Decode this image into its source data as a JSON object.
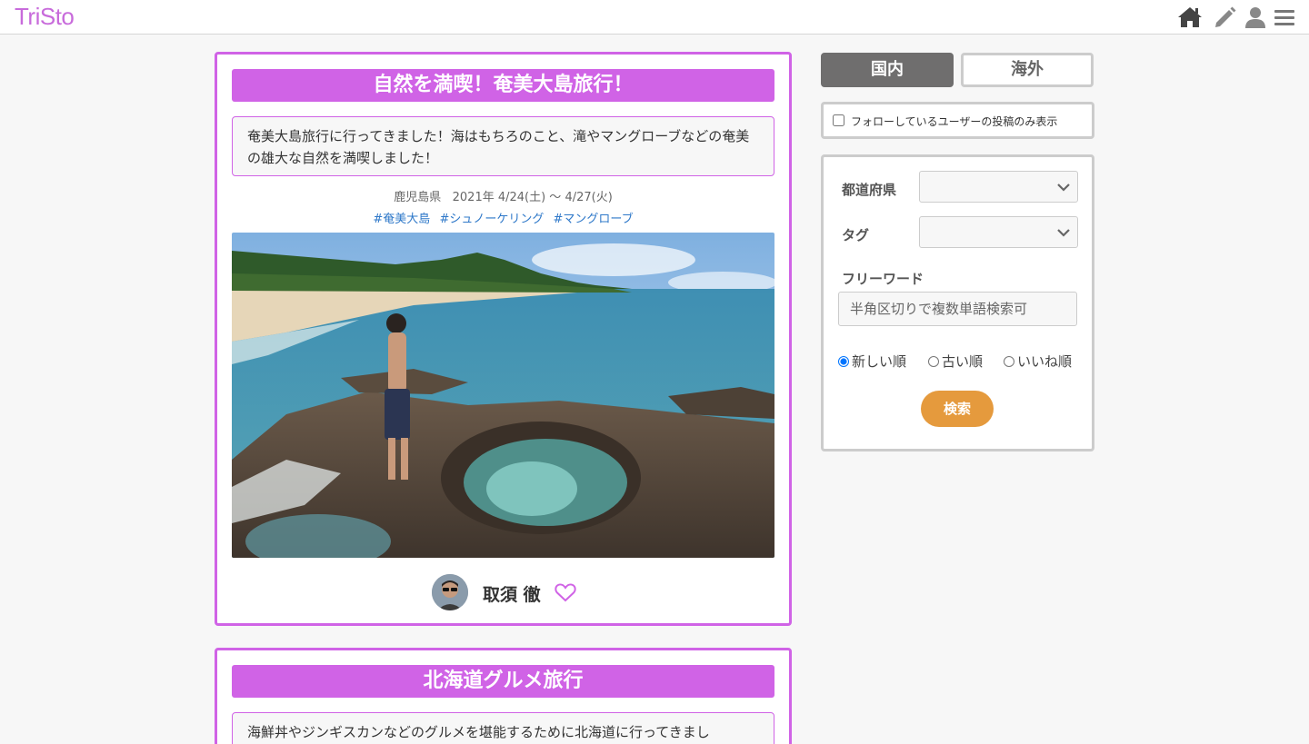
{
  "header": {
    "logo": "TriSto",
    "icons": [
      "home-icon",
      "pencil-icon",
      "user-icon",
      "menu-icon"
    ]
  },
  "posts": [
    {
      "title": "自然を満喫！奄美大島旅行！",
      "description": "奄美大島旅行に行ってきました！海はもちろのこと、滝やマングローブなどの奄美の雄大な自然を満喫しました！",
      "prefecture": "鹿児島県",
      "dates": "2021年 4/24(土) 〜 4/27(火)",
      "tags": [
        "#奄美大島",
        "#シュノーケリング",
        "#マングローブ"
      ],
      "author": "取須 徹"
    },
    {
      "title": "北海道グルメ旅行",
      "description": "海鮮丼やジンギスカンなどのグルメを堪能するために北海道に行ってきまし"
    }
  ],
  "sidebar": {
    "tabs": [
      {
        "label": "国内",
        "active": true
      },
      {
        "label": "海外",
        "active": false
      }
    ],
    "follow_only_label": "フォローしているユーザーの投稿のみ表示",
    "prefecture_label": "都道府県",
    "tag_label": "タグ",
    "freeword_label": "フリーワード",
    "freeword_placeholder": "半角区切りで複数単語検索可",
    "sort_options": [
      {
        "label": "新しい順",
        "checked": true
      },
      {
        "label": "古い順",
        "checked": false
      },
      {
        "label": "いいね順",
        "checked": false
      }
    ],
    "search_button": "検索"
  },
  "colors": {
    "brand": "#d063e6",
    "tab_active": "#6f6e6e",
    "search_button": "#e59a3d",
    "tag_link": "#2e78c9"
  }
}
